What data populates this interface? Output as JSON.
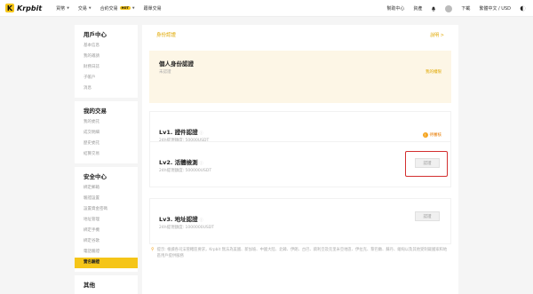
{
  "topbar": {
    "logo_mark": "K",
    "logo_text": "Krpbit",
    "nav": [
      {
        "label": "買幣",
        "dropdown": true
      },
      {
        "label": "交易",
        "dropdown": true
      },
      {
        "label": "合約交易",
        "badge": "HOT",
        "dropdown": true
      },
      {
        "label": "跟單交易",
        "dropdown": false
      }
    ],
    "right": {
      "help": "幫助中心",
      "assets": "資產",
      "download": "下載",
      "language": "繁體中文 / USD"
    }
  },
  "sidebar": {
    "sections": [
      {
        "title": "用戶中心",
        "items": [
          "基本信息",
          "我的邀請",
          "財務日誌",
          "子帳戶",
          "消息"
        ]
      },
      {
        "title": "我的交易",
        "items": [
          "我的委託",
          "成交明細",
          "歷史委託",
          "結算交易"
        ]
      },
      {
        "title": "安全中心",
        "items": [
          "綁定郵箱",
          "驗證設置",
          "設置資金密碼",
          "地址管理",
          "綁定手機",
          "綁定谷歌",
          "電話驗證",
          "實名驗證"
        ]
      },
      {
        "title": "其他",
        "items": []
      }
    ],
    "active_item": "實名驗證"
  },
  "main": {
    "title": "身份認證",
    "link": "說明 >",
    "personal": {
      "title": "個人身份認證",
      "status": "未認證",
      "link": "我的權限"
    },
    "lv1": {
      "title": "Lv1. 證件認證",
      "sub": "24h提現額度: 50000USDT",
      "status": "待審核"
    },
    "lv2": {
      "title": "Lv2. 活體檢測",
      "sub": "24h提現額度: 500000USDT",
      "button": "認證"
    },
    "lv3": {
      "title": "Lv3. 地址認證",
      "sub": "24h提現額度: 1000000USDT",
      "button": "認證"
    },
    "notice": "提示: 根據各司法管轄區要求，Krpbit 無法為美國、新加坡、中國大陸、北韓、伊朗、古巴、敘利亞及克里米亞地區、伊拉克、黎巴嫩、蘇丹、緬甸以及其他受制裁國家和地區用戶提供服務"
  },
  "colors": {
    "accent": "#f5c518",
    "highlight": "#d32f2f",
    "link": "#e0a800"
  }
}
